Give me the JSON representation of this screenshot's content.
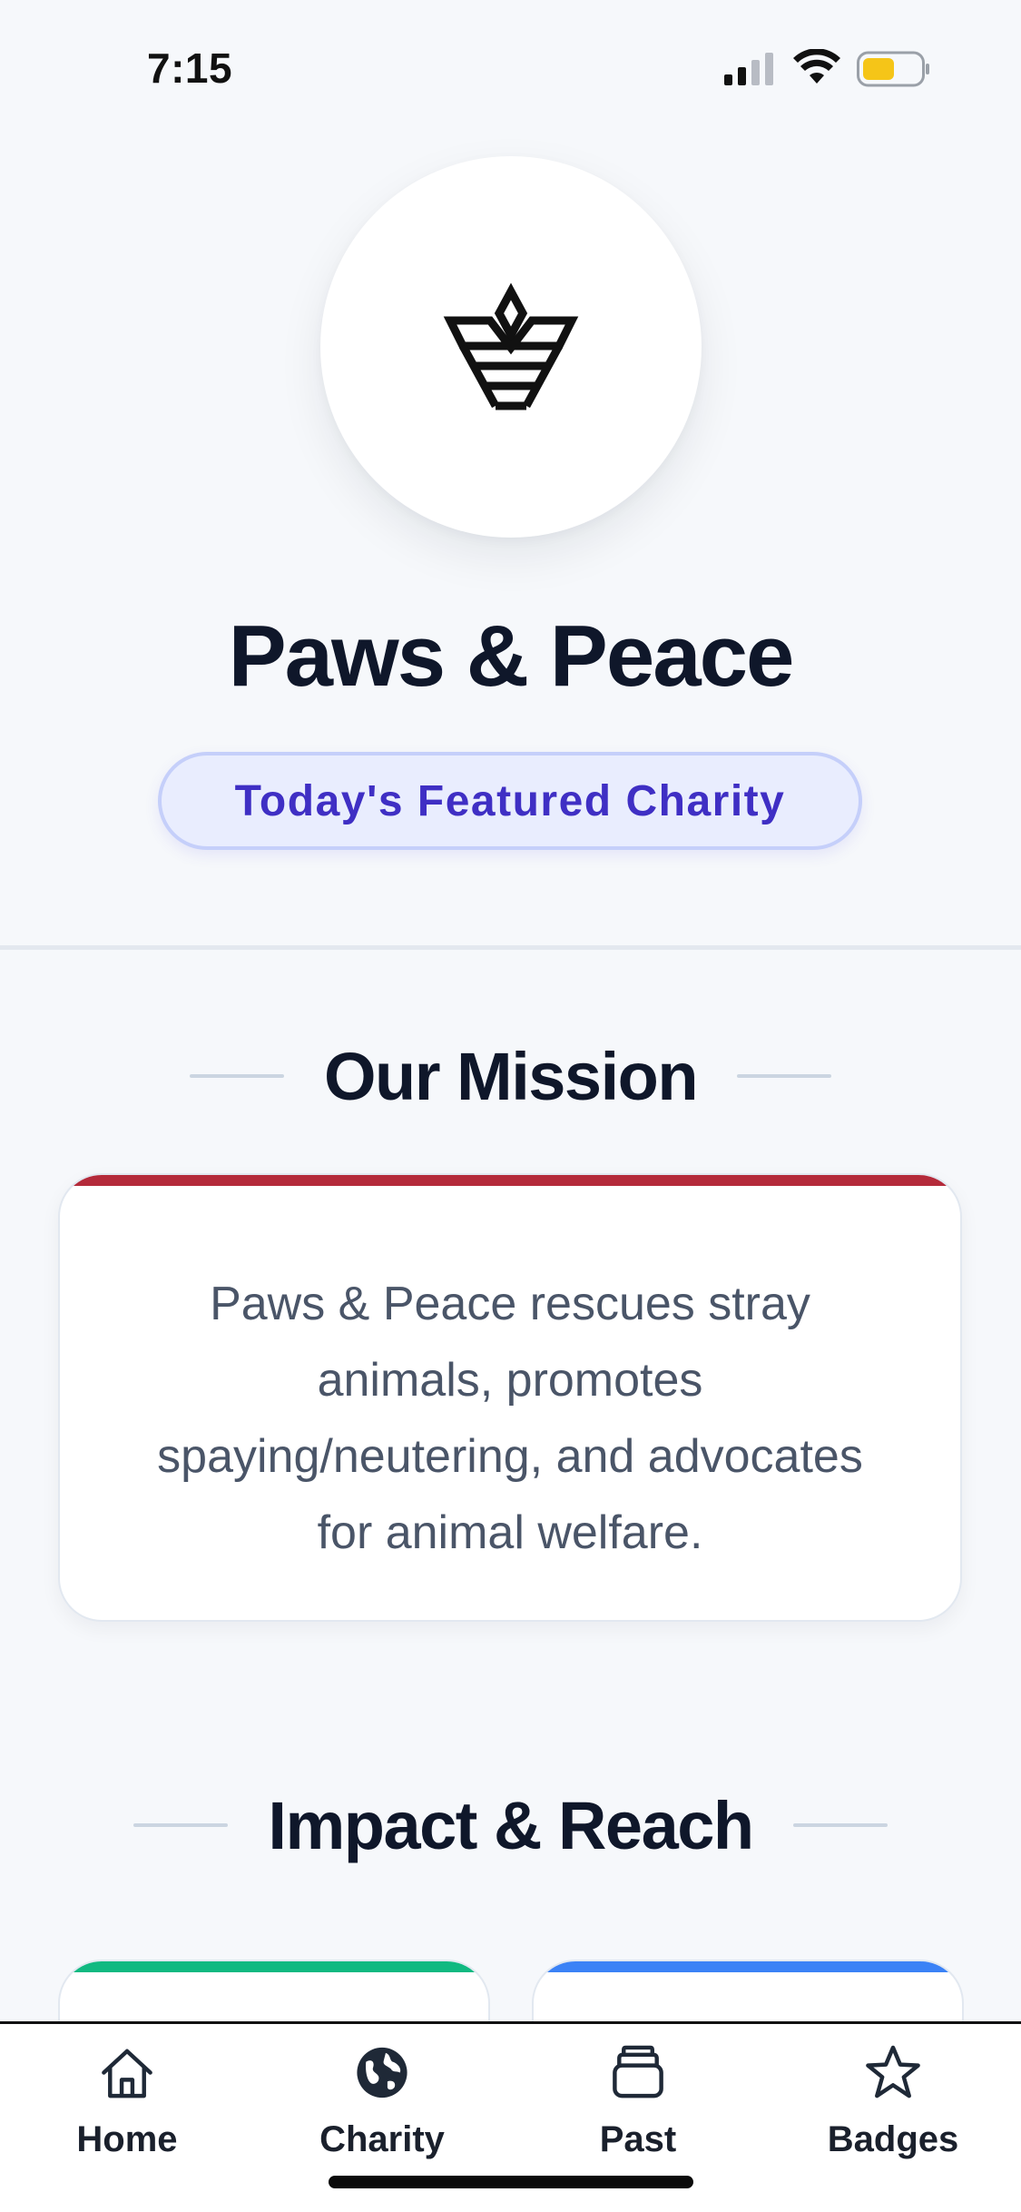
{
  "status_bar": {
    "time": "7:15",
    "icons": [
      "signal-icon",
      "wifi-icon",
      "battery-icon"
    ],
    "battery_color": "#f5c518"
  },
  "charity": {
    "name": "Paws & Peace",
    "logo_icon": "charity-logo-icon",
    "featured_label": "Today's Featured Charity"
  },
  "mission": {
    "heading": "Our Mission",
    "text": "Paws & Peace rescues stray animals, promotes spaying/neutering, and advocates for animal welfare.",
    "accent_color": "#b42a3a"
  },
  "impact": {
    "heading": "Impact & Reach",
    "cards": [
      {
        "accent_color": "#10b981"
      },
      {
        "accent_color": "#3b82f6"
      }
    ]
  },
  "tab_bar": {
    "tabs": [
      {
        "label": "Home",
        "icon": "home-icon"
      },
      {
        "label": "Charity",
        "icon": "globe-icon"
      },
      {
        "label": "Past",
        "icon": "archive-icon"
      },
      {
        "label": "Badges",
        "icon": "star-icon"
      }
    ]
  },
  "colors": {
    "background": "#f6f8fb",
    "badge_text": "#3f2fc4",
    "badge_bg": "#e9edfe",
    "heading": "#0f172a",
    "body_text": "#4a5568"
  }
}
